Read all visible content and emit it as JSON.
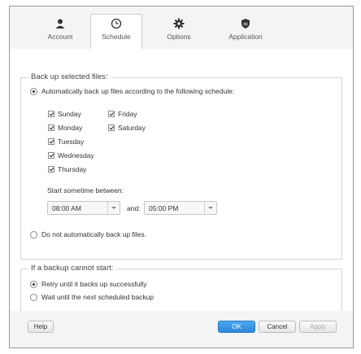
{
  "tabs": [
    {
      "label": "Account",
      "icon": "person-icon"
    },
    {
      "label": "Schedule",
      "icon": "clock-icon"
    },
    {
      "label": "Options",
      "icon": "gear-icon"
    },
    {
      "label": "Application",
      "icon": "shield-icon"
    }
  ],
  "active_tab": "Schedule",
  "backup_group": {
    "title": "Back up selected files:",
    "auto_option": "Automatically back up files according to the following schedule:",
    "auto_selected": true,
    "days": [
      {
        "label": "Sunday",
        "checked": true
      },
      {
        "label": "Monday",
        "checked": true
      },
      {
        "label": "Tuesday",
        "checked": true
      },
      {
        "label": "Wednesday",
        "checked": true
      },
      {
        "label": "Thursday",
        "checked": true
      },
      {
        "label": "Friday",
        "checked": true
      },
      {
        "label": "Saturday",
        "checked": true
      }
    ],
    "start_label": "Start sometime between:",
    "start_time": "08:00 AM",
    "and_label": "and:",
    "end_time": "05:00 PM",
    "manual_option": "Do not automatically back up files."
  },
  "failure_group": {
    "title": "If a backup cannot start:",
    "retry_option": "Retry until it backs up successfully",
    "wait_option": "Wait until the next scheduled backup",
    "retry_selected": true
  },
  "footer": {
    "help": "Help",
    "ok": "OK",
    "cancel": "Cancel",
    "apply": "Apply"
  },
  "colors": {
    "accent": "#2e86d8"
  }
}
